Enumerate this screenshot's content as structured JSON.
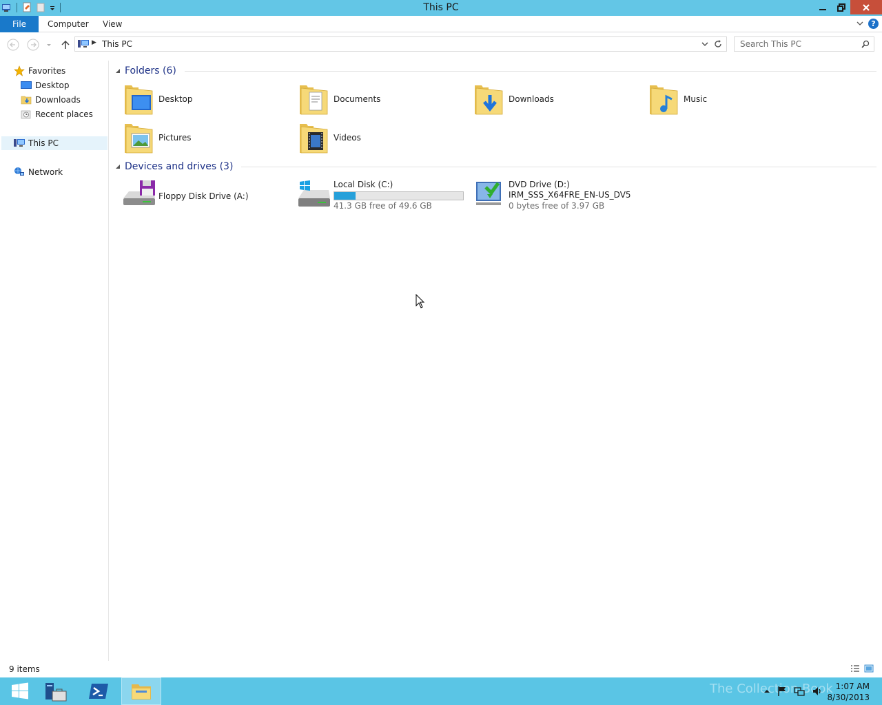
{
  "window": {
    "title": "This PC"
  },
  "ribbon": {
    "tabs": [
      {
        "label": "File"
      },
      {
        "label": "Computer"
      },
      {
        "label": "View"
      }
    ]
  },
  "address": {
    "path": "This PC"
  },
  "search": {
    "placeholder": "Search This PC"
  },
  "nav_pane": {
    "favorites": {
      "label": "Favorites",
      "items": [
        {
          "label": "Desktop"
        },
        {
          "label": "Downloads"
        },
        {
          "label": "Recent places"
        }
      ]
    },
    "this_pc": {
      "label": "This PC"
    },
    "network": {
      "label": "Network"
    }
  },
  "folders": {
    "header": "Folders (6)",
    "items": [
      {
        "label": "Desktop",
        "icon": "desktop-folder-icon"
      },
      {
        "label": "Documents",
        "icon": "documents-folder-icon"
      },
      {
        "label": "Downloads",
        "icon": "downloads-folder-icon"
      },
      {
        "label": "Music",
        "icon": "music-folder-icon"
      },
      {
        "label": "Pictures",
        "icon": "pictures-folder-icon"
      },
      {
        "label": "Videos",
        "icon": "videos-folder-icon"
      }
    ]
  },
  "drives": {
    "header": "Devices and drives (3)",
    "items": [
      {
        "label": "Floppy Disk Drive (A:)",
        "icon": "floppy-drive-icon"
      },
      {
        "label": "Local Disk (C:)",
        "free": "41.3 GB free of 49.6 GB",
        "used_fraction": 0.167,
        "icon": "hard-disk-icon"
      },
      {
        "label": "DVD Drive (D:)",
        "volume": "IRM_SSS_X64FRE_EN-US_DV5",
        "free": "0 bytes free of 3.97 GB",
        "icon": "dvd-drive-icon"
      }
    ]
  },
  "status": {
    "count": "9 items"
  },
  "taskbar": {
    "clock_time": "1:07 AM",
    "clock_date": "8/30/2013",
    "watermark": "The Collection Book"
  },
  "colors": {
    "accent": "#1979ca",
    "titlebar": "#63c6e6",
    "taskbar": "#5ac5e5",
    "capacity": "#26a0da"
  }
}
